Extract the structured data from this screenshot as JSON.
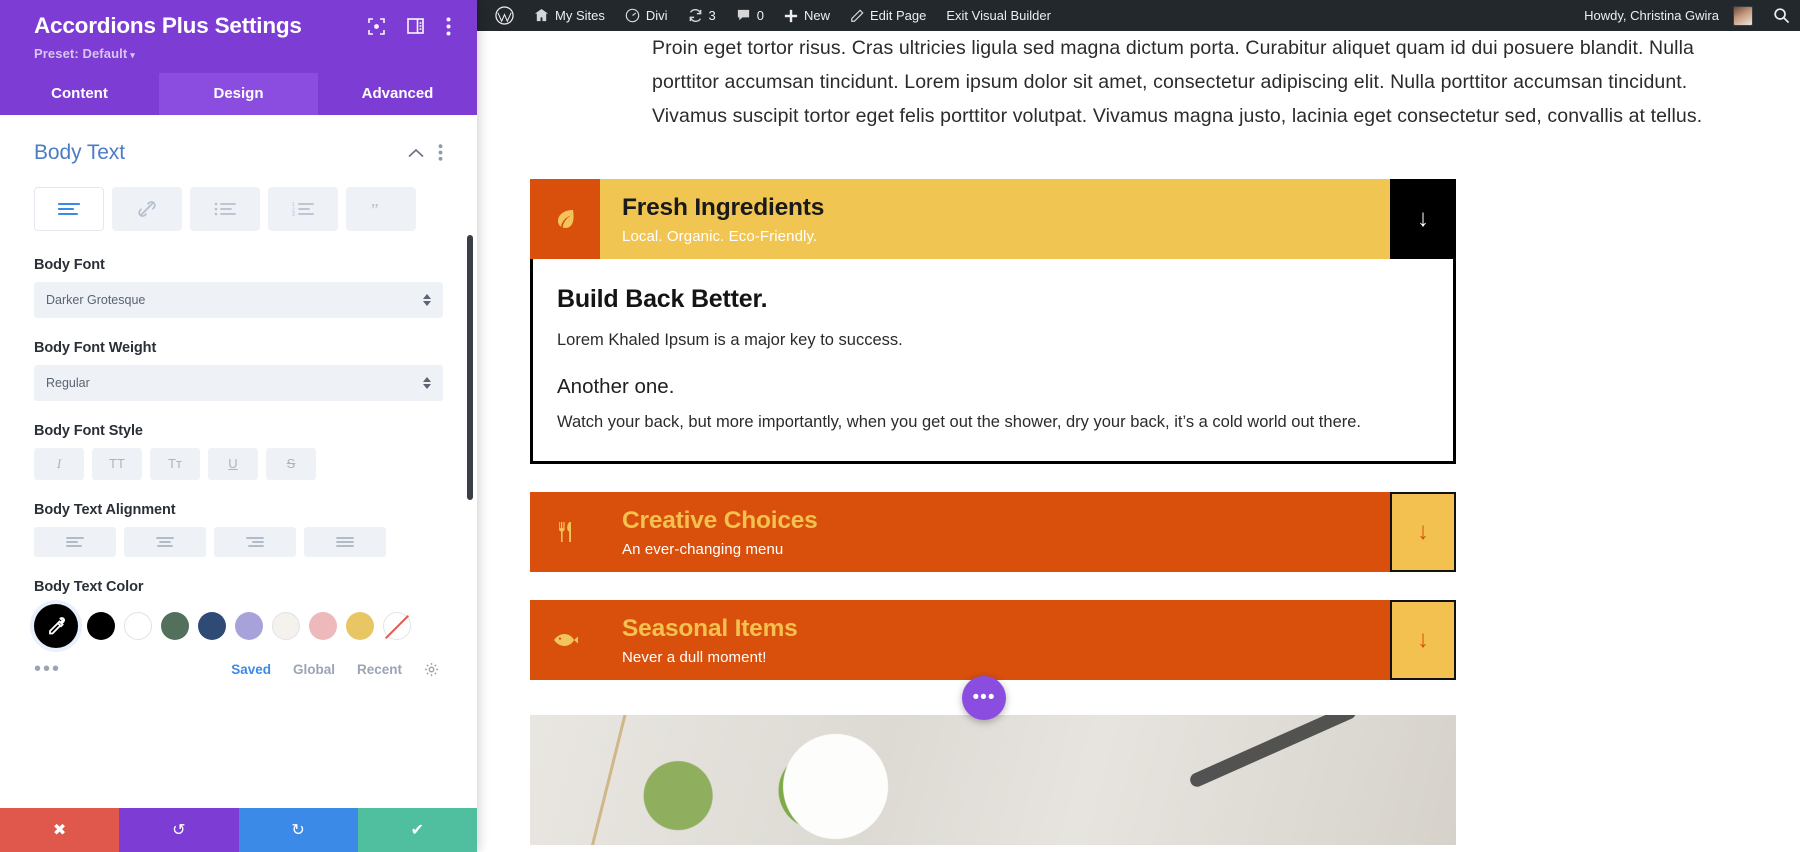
{
  "settings": {
    "title": "Accordions Plus Settings",
    "preset_label": "Preset: Default",
    "preset_caret": "▾",
    "header_icons": [
      {
        "name": "focus-icon"
      },
      {
        "name": "layout-icon"
      },
      {
        "name": "more-vertical-icon"
      }
    ],
    "tabs": [
      {
        "label": "Content",
        "active": false
      },
      {
        "label": "Design",
        "active": true
      },
      {
        "label": "Advanced",
        "active": false
      }
    ],
    "section": {
      "title": "Body Text",
      "collapse_icon": "chevron-up-icon",
      "more_icon": "more-vertical-icon"
    },
    "icon_tabs": [
      {
        "name": "paragraph-icon",
        "active": true
      },
      {
        "name": "link-icon",
        "active": false
      },
      {
        "name": "unordered-list-icon",
        "active": false
      },
      {
        "name": "ordered-list-icon",
        "active": false
      },
      {
        "name": "blockquote-icon",
        "active": false
      }
    ],
    "body_font": {
      "label": "Body Font",
      "value": "Darker Grotesque"
    },
    "body_font_weight": {
      "label": "Body Font Weight",
      "value": "Regular"
    },
    "body_font_style": {
      "label": "Body Font Style",
      "buttons": [
        {
          "glyph": "I",
          "name": "italic-button"
        },
        {
          "glyph": "TT",
          "name": "uppercase-button"
        },
        {
          "glyph": "Tᴛ",
          "name": "smallcaps-button"
        },
        {
          "glyph": "U",
          "name": "underline-button"
        },
        {
          "glyph": "S",
          "name": "strikethrough-button"
        }
      ]
    },
    "body_text_alignment": {
      "label": "Body Text Alignment",
      "options": [
        "align-left",
        "align-center",
        "align-right",
        "align-justify"
      ]
    },
    "body_text_color": {
      "label": "Body Text Color",
      "picker_icon": "eyedropper-icon",
      "swatches": [
        {
          "name": "swatch-black",
          "color": "#000000"
        },
        {
          "name": "swatch-white",
          "color": "#ffffff"
        },
        {
          "name": "swatch-sage",
          "color": "#53705d"
        },
        {
          "name": "swatch-navy",
          "color": "#304a76"
        },
        {
          "name": "swatch-lavender",
          "color": "#a7a3da"
        },
        {
          "name": "swatch-offwhite",
          "color": "#f5f1ed"
        },
        {
          "name": "swatch-pink",
          "color": "#eeb9bb"
        },
        {
          "name": "swatch-gold",
          "color": "#e8c663"
        }
      ],
      "none_label": "no-color",
      "more_dots": "•••",
      "tabs": [
        {
          "label": "Saved",
          "active": true
        },
        {
          "label": "Global",
          "active": false
        },
        {
          "label": "Recent",
          "active": false
        }
      ],
      "gear_icon": "gear-icon"
    },
    "footer_buttons": [
      {
        "name": "cancel-button",
        "glyph": "✖",
        "color": "#e0574c"
      },
      {
        "name": "undo-button",
        "glyph": "↺",
        "color": "#7d3cd4"
      },
      {
        "name": "redo-button",
        "glyph": "↻",
        "color": "#3b8ae8"
      },
      {
        "name": "save-button",
        "glyph": "✔",
        "color": "#4fbf9f"
      }
    ]
  },
  "adminbar": {
    "items": [
      {
        "name": "wordpress-logo-icon",
        "label": ""
      },
      {
        "name": "my-sites",
        "label": "My Sites"
      },
      {
        "name": "divi",
        "label": "Divi"
      },
      {
        "name": "updates",
        "label": "3"
      },
      {
        "name": "comments",
        "label": "0"
      },
      {
        "name": "new",
        "label": "New"
      },
      {
        "name": "edit-page",
        "label": "Edit Page"
      },
      {
        "name": "exit-visual-builder",
        "label": "Exit Visual Builder"
      }
    ],
    "howdy": "Howdy, Christina Gwira",
    "search_icon": "search-icon"
  },
  "preview": {
    "intro_paragraph": "Proin eget tortor risus. Cras ultricies ligula sed magna dictum porta. Curabitur aliquet quam id dui posuere blandit. Nulla porttitor accumsan tincidunt. Lorem ipsum dolor sit amet, consectetur adipiscing elit. Nulla porttitor accumsan tincidunt. Vivamus suscipit tortor eget felis porttitor volutpat. Vivamus magna justo, lacinia eget consectetur sed, convallis at tellus.",
    "accordions": [
      {
        "title": "Fresh Ingredients",
        "subtitle": "Local. Organic. Eco-Friendly.",
        "icon": "leaf-icon",
        "icon_glyph": "❦",
        "toggle_glyph": "↓",
        "open": true
      },
      {
        "title": "Creative Choices",
        "subtitle": "An ever-changing menu",
        "icon": "fork-knife-icon",
        "icon_glyph": "🍴",
        "toggle_glyph": "↓",
        "open": false
      },
      {
        "title": "Seasonal Items",
        "subtitle": "Never a dull moment!",
        "icon": "fish-icon",
        "icon_glyph": "➤",
        "toggle_glyph": "↓",
        "open": false
      }
    ],
    "panel": {
      "heading": "Build Back Better.",
      "paragraph1": "Lorem Khaled Ipsum is a major key to success.",
      "heading2": "Another one.",
      "paragraph2": "Watch your back, but more importantly, when you get out the shower, dry your back, it’s a cold world out there."
    },
    "fab_glyph": "•••",
    "fab_name": "page-settings-fab"
  },
  "colors": {
    "purple": "#7d3cd4",
    "purple_active": "#8b4ce0",
    "accent_blue": "#3b8ae8",
    "accordion_orange": "#d9500c",
    "accordion_yellow": "#f0c551",
    "admin_dark": "#23282d"
  }
}
